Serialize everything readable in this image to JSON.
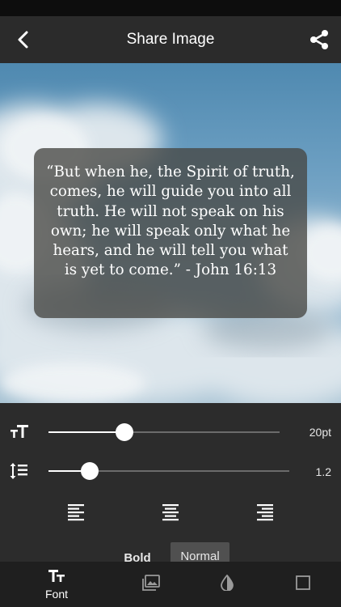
{
  "nav": {
    "title": "Share Image",
    "back_icon": "chevron-left-icon",
    "share_icon": "share-icon"
  },
  "quote": {
    "text": "“But when he, the Spirit of truth, comes, he will guide you into all truth. He will not speak on his own; he will speak only what he hears, and he will tell you what is yet to come.” - John 16:13"
  },
  "controls": {
    "font_size": {
      "icon": "font-size-icon",
      "value_label": "20pt",
      "level": 0.33
    },
    "line_spacing": {
      "icon": "line-spacing-icon",
      "value_label": "1.2",
      "level": 0.17
    },
    "alignments": [
      {
        "name": "left",
        "icon": "align-left-icon"
      },
      {
        "name": "center",
        "icon": "align-center-icon"
      },
      {
        "name": "right",
        "icon": "align-right-icon"
      }
    ],
    "weight_options": [
      "Bold",
      "Normal"
    ],
    "selected_weight": "Normal"
  },
  "tabs": [
    {
      "icon": "font-icon",
      "label": "Font",
      "active": true
    },
    {
      "icon": "image-icon",
      "label": "",
      "active": false
    },
    {
      "icon": "contrast-icon",
      "label": "",
      "active": false
    },
    {
      "icon": "square-icon",
      "label": "",
      "active": false
    }
  ],
  "colors": {
    "nav_bg": "#2b2b2b",
    "panel_bg": "#2c2c2c",
    "tab_bar_bg": "#1f1f1f",
    "accent": "#ffffff"
  }
}
